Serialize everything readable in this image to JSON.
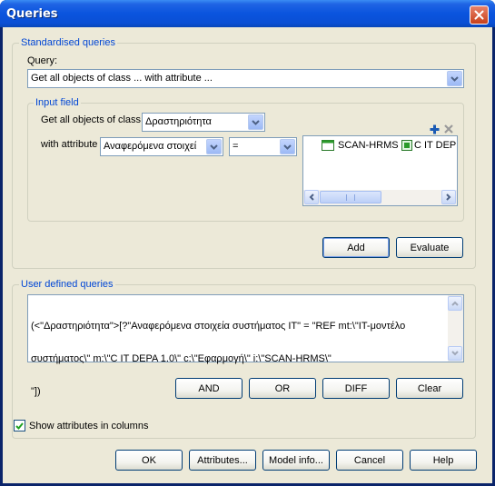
{
  "window": {
    "title": "Queries"
  },
  "standardised": {
    "legend": "Standardised queries",
    "query_label": "Query:",
    "query_value": "Get all objects of class ... with attribute ..."
  },
  "input_field": {
    "legend": "Input field",
    "class_label": "Get all objects of class",
    "class_value": "Δραστηριότητα",
    "attribute_label": "with attribute",
    "attribute_value": "Αναφερόμενα στοιχεί",
    "operator_value": "=",
    "list_items": [
      {
        "icon": "class-icon",
        "label": "SCAN-HRMS"
      },
      {
        "icon": "object-icon",
        "label": "C IT DEP"
      }
    ],
    "add_label": "Add",
    "evaluate_label": "Evaluate"
  },
  "user_defined": {
    "legend": "User defined queries",
    "text_lines": [
      "(<\"Δραστηριότητα\">[?\"Αναφερόμενα στοιχεία συστήματος IT\" = \"REF mt:\\\"IT-μοντέλο",
      "συστήματος\\\" m:\\\"C IT DEPA 1.0\\\" c:\\\"Εφαρμογή\\\" i:\\\"SCAN-HRMS\\\"",
      "\"])"
    ],
    "and_label": "AND",
    "or_label": "OR",
    "diff_label": "DIFF",
    "clear_label": "Clear"
  },
  "show_attributes": {
    "label": "Show attributes in columns",
    "checked": true
  },
  "footer": {
    "ok_label": "OK",
    "attributes_label": "Attributes...",
    "model_info_label": "Model info...",
    "cancel_label": "Cancel",
    "help_label": "Help"
  },
  "colors": {
    "title_bar": "#0a54de",
    "group_legend": "#0046d5",
    "dialog_bg": "#ece9d8",
    "close_button": "#c8401a"
  }
}
